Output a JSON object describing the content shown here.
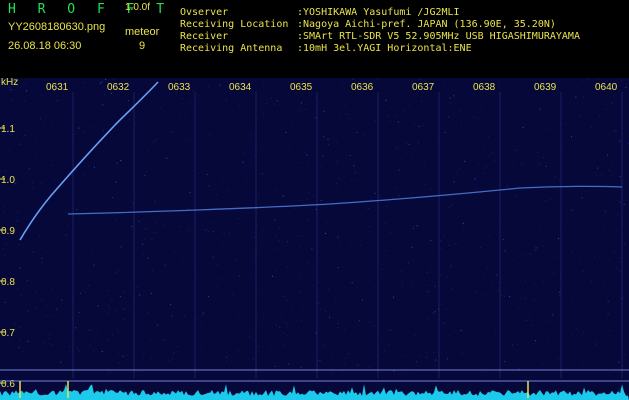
{
  "header": {
    "title": "H R O F F T",
    "version": "1.0.0f",
    "filename": "YY2608180630.png",
    "meteor_label": "meteor",
    "meteor_count": "9",
    "datetime": "26.08.18 06:30"
  },
  "info": [
    {
      "label": "Ovserver",
      "value": ":YOSHIKAWA Yasufumi /JG2MLI"
    },
    {
      "label": "Receiving Location",
      "value": ":Nagoya Aichi-pref. JAPAN (136.90E, 35.20N)"
    },
    {
      "label": "Receiver",
      "value": ":SMArt RTL-SDR V5 52.905MHz USB HIGASHIMURAYAMA"
    },
    {
      "label": "Receiving Antenna",
      "value": ":10mH 3el.YAGI Horizontal:ENE"
    }
  ],
  "spectrogram": {
    "y_unit": "kHz",
    "y_ticks": [
      "1.1",
      "1.0",
      "0.9",
      "0.8",
      "0.7",
      "0.6"
    ],
    "y_values": [
      1.1,
      1.0,
      0.9,
      0.8,
      0.7,
      0.6
    ],
    "time_ticks": [
      "0631",
      "0632",
      "0633",
      "0634",
      "0635",
      "0636",
      "0637",
      "0638",
      "0639",
      "0640"
    ],
    "colors": {
      "background": "#07083a",
      "trace": "#6fa8ff",
      "gridline": "#2b3a8a",
      "label": "#e9e34a",
      "noise": "#1fe0ff"
    }
  }
}
